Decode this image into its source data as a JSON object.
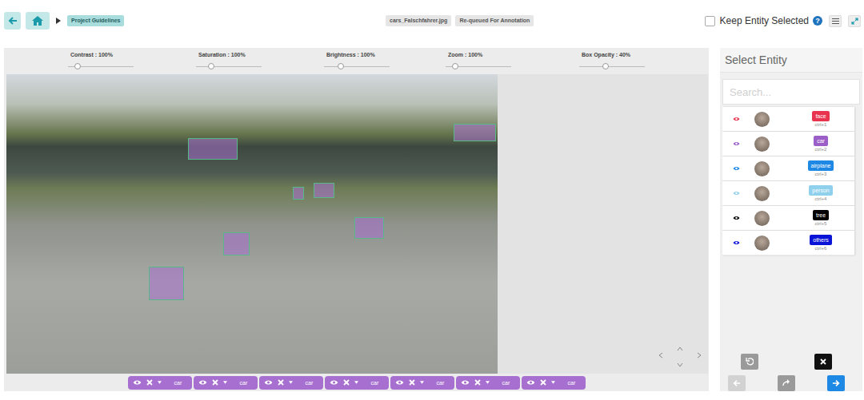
{
  "toolbar": {
    "crumb": "Project Guidelines",
    "file": "cars_Falschfahrer.jpg",
    "status": "Re-queued For Annotation",
    "keep_selected": {
      "label": "Keep Entity Selected",
      "checked": false
    },
    "help": "?"
  },
  "sliders": [
    {
      "label": "Contrast : 100%",
      "level": 0.15
    },
    {
      "label": "Saturation : 100%",
      "level": 0.23
    },
    {
      "label": "Brightness : 100%",
      "level": 0.25
    },
    {
      "label": "Zoom : 100%",
      "level": 0.15
    },
    {
      "label": "Box Opacity : 40%",
      "level": 0.4
    }
  ],
  "annotations": [
    {
      "label": "car",
      "color": "#a76fcf",
      "visible": true
    },
    {
      "label": "car",
      "color": "#a76fcf",
      "visible": true
    },
    {
      "label": "car",
      "color": "#a76fcf",
      "visible": true
    },
    {
      "label": "car",
      "color": "#a76fcf",
      "visible": true
    },
    {
      "label": "car",
      "color": "#a76fcf",
      "visible": true
    },
    {
      "label": "car",
      "color": "#a76fcf",
      "visible": true
    },
    {
      "label": "car",
      "color": "#a76fcf",
      "visible": true
    }
  ],
  "entity_panel": {
    "title": "Select Entity",
    "search": {
      "placeholder": "Search..."
    },
    "entities": [
      {
        "name": "face",
        "shortcut": "ctrl+1",
        "color": "#e8344e",
        "visible": true
      },
      {
        "name": "car",
        "shortcut": "ctrl+2",
        "color": "#9c5fc7",
        "visible": true
      },
      {
        "name": "airplane",
        "shortcut": "ctrl+3",
        "color": "#1e88e5",
        "visible": true
      },
      {
        "name": "person",
        "shortcut": "ctrl+4",
        "color": "#8fd0ec",
        "visible": true
      },
      {
        "name": "tree",
        "shortcut": "ctrl+5",
        "color": "#000000",
        "visible": true
      },
      {
        "name": "others",
        "shortcut": "ctrl+6",
        "color": "#0a14d6",
        "visible": true
      }
    ]
  }
}
